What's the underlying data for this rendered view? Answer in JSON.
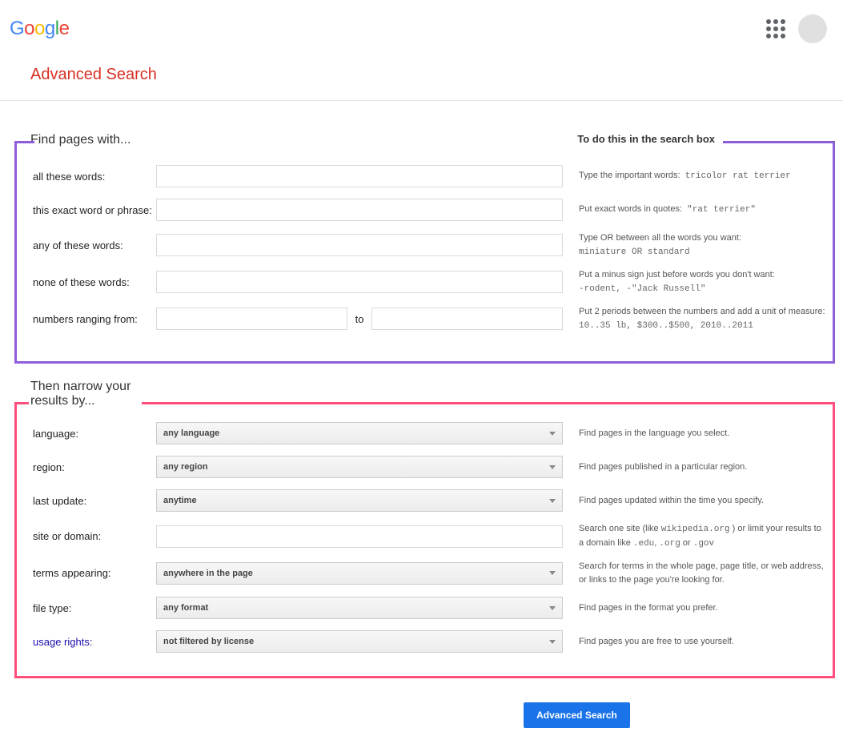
{
  "header": {
    "logo_chars": [
      "G",
      "o",
      "o",
      "g",
      "l",
      "e"
    ]
  },
  "title": "Advanced Search",
  "section1": {
    "heading": "Find pages with...",
    "right_heading": "To do this in the search box",
    "rows": [
      {
        "label": "all these words:",
        "help": "Type the important words:",
        "code": "tricolor rat terrier"
      },
      {
        "label": "this exact word or phrase:",
        "help": "Put exact words in quotes:",
        "code": "\"rat terrier\""
      },
      {
        "label": "any of these words:",
        "help": "Type OR between all the words you want:",
        "code": "miniature OR standard"
      },
      {
        "label": "none of these words:",
        "help": "Put a minus sign just before words you don't want:",
        "code": "-rodent, -\"Jack Russell\""
      },
      {
        "label": "numbers ranging from:",
        "to": "to",
        "help": "Put 2 periods between the numbers and add a unit of measure:",
        "code": "10..35 lb, $300..$500, 2010..2011"
      }
    ]
  },
  "section2": {
    "heading": "Then narrow your results by...",
    "rows": [
      {
        "label": "language:",
        "value": "any language",
        "help": "Find pages in the language you select."
      },
      {
        "label": "region:",
        "value": "any region",
        "help": "Find pages published in a particular region."
      },
      {
        "label": "last update:",
        "value": "anytime",
        "help": "Find pages updated within the time you specify."
      },
      {
        "label": "site or domain:",
        "input": true,
        "help_html": "Search one site (like <span class='code'>wikipedia.org</span> ) or limit your results to a domain like <span class='code'>.edu</span>, <span class='code'>.org</span> or <span class='code'>.gov</span>"
      },
      {
        "label": "terms appearing:",
        "value": "anywhere in the page",
        "help": "Search for terms in the whole page, page title, or web address, or links to the page you're looking for."
      },
      {
        "label": "file type:",
        "value": "any format",
        "help": "Find pages in the format you prefer."
      },
      {
        "label": "usage rights:",
        "link": true,
        "value": "not filtered by license",
        "help": "Find pages you are free to use yourself."
      }
    ]
  },
  "submit": "Advanced Search"
}
